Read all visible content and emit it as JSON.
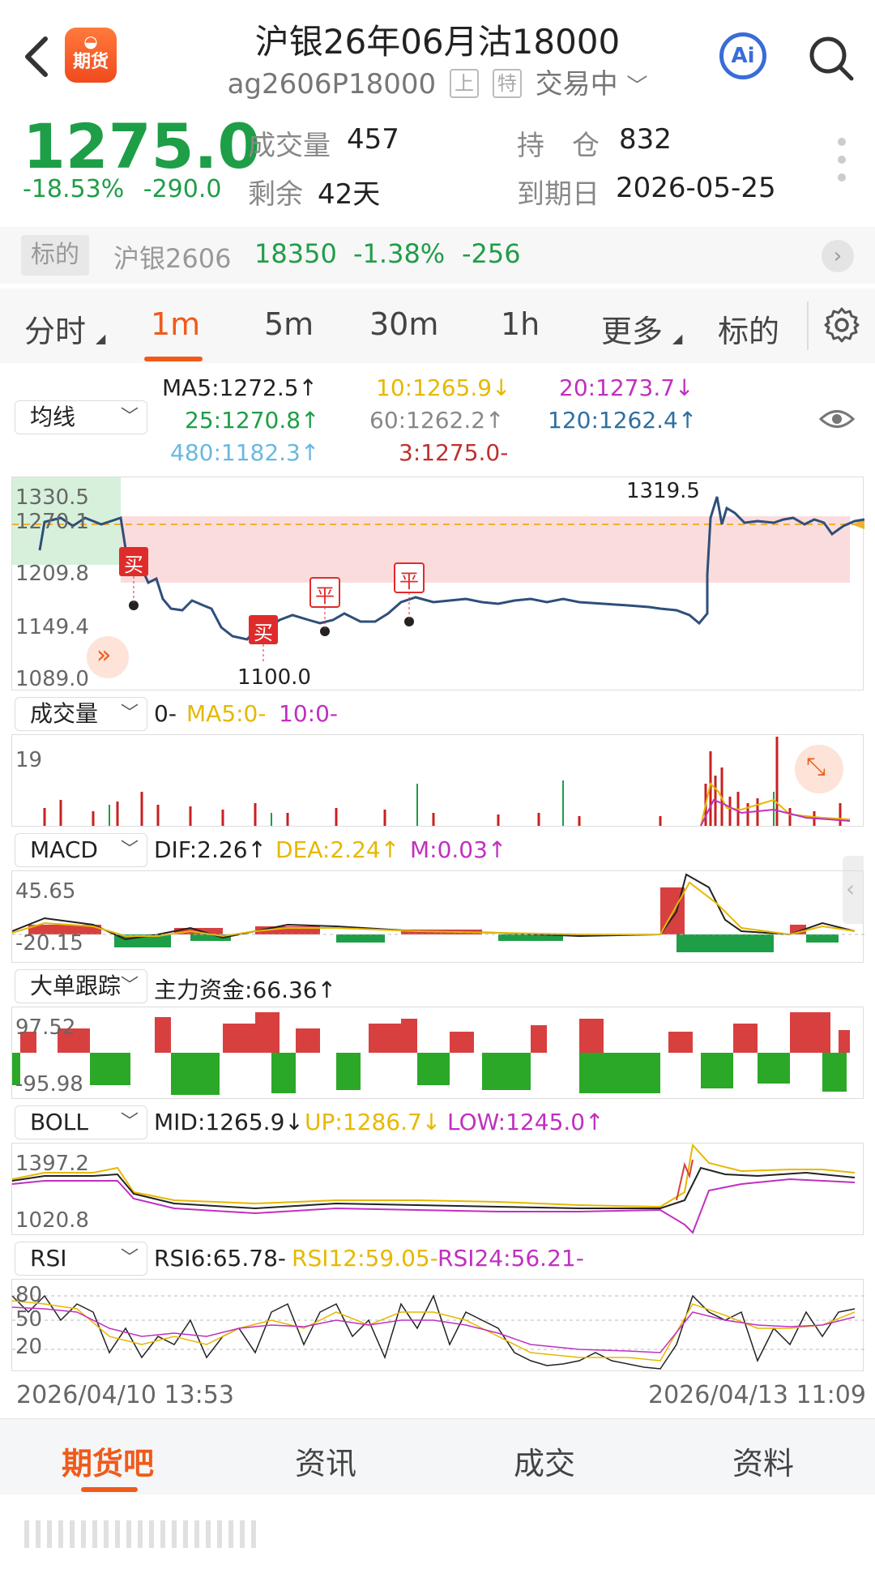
{
  "header": {
    "title": "沪银26年06月沽18000",
    "code": "ag2606P18000",
    "tag1": "上",
    "tag2": "特",
    "status": "交易中",
    "logo_label": "期货",
    "ai_label": "Ai"
  },
  "quote": {
    "price": "1275.0",
    "change_pct": "-18.53%",
    "change_abs": "-290.0",
    "volume_label": "成交量",
    "volume": "457",
    "remaining_label": "剩余",
    "remaining": "42天",
    "open_interest_label": "持　仓",
    "open_interest": "832",
    "expiry_label": "到期日",
    "expiry": "2026-05-25"
  },
  "underlying": {
    "label": "标的",
    "name": "沪银2606",
    "price": "18350",
    "change_pct": "-1.38%",
    "change_abs": "-256"
  },
  "tabs": [
    {
      "label": "分时"
    },
    {
      "label": "1m"
    },
    {
      "label": "5m"
    },
    {
      "label": "30m"
    },
    {
      "label": "1h"
    },
    {
      "label": "更多"
    },
    {
      "label": "标的"
    }
  ],
  "ma": {
    "selector": "均线",
    "ma5": "MA5:1272.5↑",
    "ma10": "10:1265.9↓",
    "ma20": "20:1273.7↓",
    "ma25": "25:1270.8↑",
    "ma60": "60:1262.2↑",
    "ma120": "120:1262.4↑",
    "ma480": "480:1182.3↑",
    "ma3": "3:1275.0-"
  },
  "main_chart": {
    "ticks": [
      "1330.5",
      "1270.1",
      "1209.8",
      "1149.4",
      "1089.0"
    ],
    "high_label": "1319.5",
    "low_label": "1100.0",
    "markers": [
      "买",
      "买",
      "平",
      "平"
    ]
  },
  "volume": {
    "selector": "成交量",
    "v": "0-",
    "ma5": "MA5:0-",
    "ma10": "10:0-",
    "tick": "19"
  },
  "macd": {
    "selector": "MACD",
    "dif": "DIF:2.26↑",
    "dea": "DEA:2.24↑",
    "m": "M:0.03↑",
    "tick_hi": "45.65",
    "tick_lo": "-20.15"
  },
  "bigorder": {
    "selector": "大单跟踪",
    "main": "主力资金:66.36↑",
    "tick_hi": "97.52",
    "tick_lo": "-95.98"
  },
  "boll": {
    "selector": "BOLL",
    "mid": "MID:1265.9↓",
    "up": "UP:1286.7↓",
    "low": "LOW:1245.0↑",
    "tick_hi": "1397.2",
    "tick_lo": "1020.8"
  },
  "rsi": {
    "selector": "RSI",
    "rsi6": "RSI6:65.78-",
    "rsi12": "RSI12:59.05-",
    "rsi24": "RSI24:56.21-",
    "ticks": [
      "80",
      "50",
      "20"
    ]
  },
  "dates": {
    "start": "2026/04/10 13:53",
    "end": "2026/04/13 11:09"
  },
  "bottom_nav": [
    {
      "label": "期货吧"
    },
    {
      "label": "资讯"
    },
    {
      "label": "成交"
    },
    {
      "label": "资料"
    }
  ],
  "colors": {
    "up": "#e03030",
    "down": "#1e9e47",
    "accent": "#f05a1a",
    "line": "#2f4f7a"
  }
}
